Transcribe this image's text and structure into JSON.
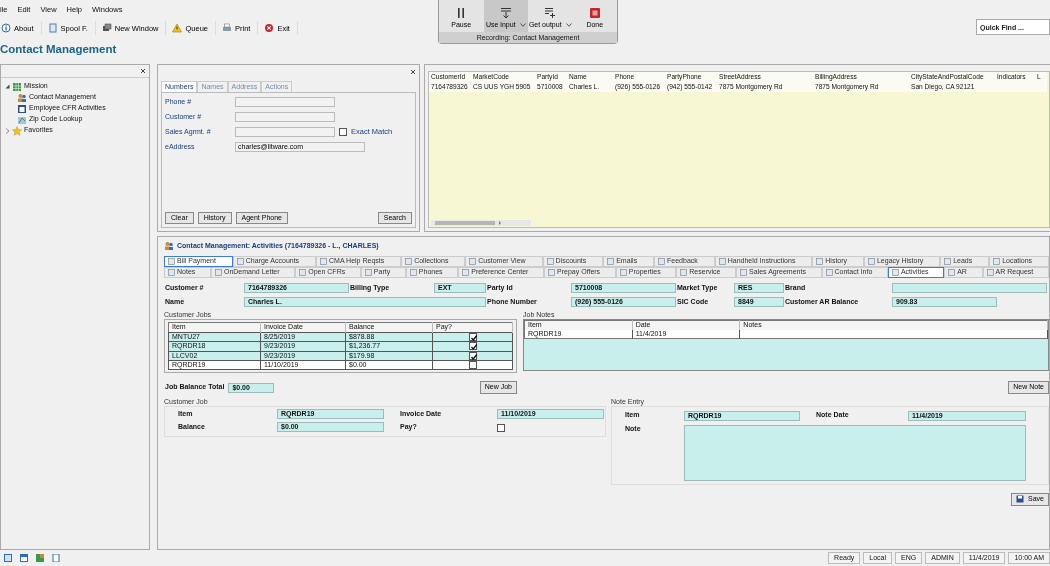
{
  "menu": [
    "ile",
    "Edit",
    "View",
    "Help",
    "Windows"
  ],
  "toolbar": [
    "About",
    "Spool F.",
    "New Window",
    "Queue",
    "Print",
    "Exit"
  ],
  "recorder": {
    "buttons": [
      {
        "label": "Pause",
        "dropdown": false,
        "highlighted": false
      },
      {
        "label": "Use input",
        "dropdown": true,
        "highlighted": true
      },
      {
        "label": "Get output",
        "dropdown": true,
        "highlighted": false
      },
      {
        "label": "Done",
        "dropdown": false,
        "highlighted": false
      }
    ],
    "caption": "Recording: Contact Management"
  },
  "quick_find": {
    "placeholder": "Quick Find ..."
  },
  "page_title": "Contact Management",
  "navigator": {
    "tree": [
      {
        "label": "Mission",
        "expanded": true,
        "children": [
          {
            "label": "Contact Management"
          },
          {
            "label": "Employee CFR Activities"
          },
          {
            "label": "Zip Code Lookup"
          }
        ]
      },
      {
        "label": "Favorites",
        "expanded": false
      }
    ]
  },
  "search": {
    "tabs": [
      {
        "label": "Numbers",
        "selected": true
      },
      {
        "label": "Names",
        "selected": false
      },
      {
        "label": "Address",
        "selected": false
      },
      {
        "label": "Actions",
        "selected": false
      }
    ],
    "fields": [
      {
        "label": "Phone #"
      },
      {
        "label": "Customer #"
      },
      {
        "label": "Sales Agrmt. #",
        "option": {
          "label": "Exact Match",
          "checked": false
        }
      },
      {
        "label": "eAddress",
        "value": "charles@litware.com"
      }
    ],
    "buttons": [
      "Clear",
      "History",
      "Agent Phone",
      "Search"
    ]
  },
  "results": {
    "columns": [
      "CustomerId",
      "MarketCode",
      "PartyId",
      "Name",
      "Phone",
      "PartyPhone",
      "StreetAddress",
      "BillingAddress",
      "CityStateAndPostalCode",
      "Indicators",
      "L"
    ],
    "rows": [
      [
        "7164789326",
        "CS UUS YGH 5905",
        "5710008",
        "Charles L.",
        "(926) 555-0126",
        "(942) 555-0142",
        "7875 Montgomery Rd",
        "7875 Montgomery Rd",
        "San Diego, CA 92121"
      ]
    ]
  },
  "detail": {
    "title": "Contact Management: Activities (7164789326 - L., CHARLES)",
    "tab_rows": [
      [
        {
          "label": "Bill Payment",
          "selected": true
        },
        {
          "label": "Charge Accounts",
          "selected": false
        },
        {
          "label": "CMA Help Reqsts",
          "selected": false
        },
        {
          "label": "Collections",
          "selected": false
        },
        {
          "label": "Customer View",
          "selected": false
        },
        {
          "label": "Discounts",
          "selected": false
        },
        {
          "label": "Emails",
          "selected": false
        },
        {
          "label": "Feedback",
          "selected": false
        },
        {
          "label": "Handheld Instructions",
          "selected": false
        },
        {
          "label": "History",
          "selected": false
        },
        {
          "label": "Legacy History",
          "selected": false
        },
        {
          "label": "Leads",
          "selected": false
        },
        {
          "label": "Locations",
          "selected": false
        }
      ],
      [
        {
          "label": "Notes",
          "selected": false
        },
        {
          "label": "OnDemand Letter",
          "selected": false
        },
        {
          "label": "Open CFRs",
          "selected": false
        },
        {
          "label": "Party",
          "selected": false
        },
        {
          "label": "Phones",
          "selected": false
        },
        {
          "label": "Preference Center",
          "selected": false
        },
        {
          "label": "Prepay Offers",
          "selected": false
        },
        {
          "label": "Properties",
          "selected": false
        },
        {
          "label": "Reservice",
          "selected": false
        },
        {
          "label": "Sales Agreements",
          "selected": false
        },
        {
          "label": "Contact Info",
          "selected": false
        },
        {
          "label": "Activities",
          "selected": true
        },
        {
          "label": "AR",
          "selected": false
        },
        {
          "label": "AR Request",
          "selected": false
        }
      ]
    ],
    "fields": [
      {
        "label": "Customer #",
        "value": "7164789326"
      },
      {
        "label": "Billing Type",
        "value": "EXT"
      },
      {
        "label": "Party Id",
        "value": "5710008"
      },
      {
        "label": "Market Type",
        "value": "RES"
      },
      {
        "label": "Brand"
      },
      {
        "label": "Name",
        "value": "Charles L."
      },
      {
        "label": "Phone Number",
        "value": "(926) 555-0126"
      },
      {
        "label": "SIC Code",
        "value": "8849"
      },
      {
        "label": "Customer AR Balance",
        "value": "909.83"
      }
    ],
    "customer_jobs": {
      "title": "Customer Jobs",
      "columns": [
        "Item",
        "Invoice Date",
        "Balance",
        "Pay?"
      ],
      "rows": [
        {
          "item": "MNTU27",
          "invoice_date": "8/25/2019",
          "balance": "$878.88",
          "pay": true
        },
        {
          "item": "RQRDR18",
          "invoice_date": "9/23/2019",
          "balance": "$1,236.77",
          "pay": true
        },
        {
          "item": "LLCV02",
          "invoice_date": "9/23/2019",
          "balance": "$179.98",
          "pay": true
        },
        {
          "item": "RQRDR19",
          "invoice_date": "11/10/2019",
          "balance": "$0.00",
          "pay": false
        }
      ]
    },
    "job_notes": {
      "title": "Job Notes",
      "columns": [
        "Item",
        "Date",
        "Notes"
      ],
      "rows": [
        {
          "item": "RQRDR19",
          "date": "11/4/2019"
        }
      ]
    },
    "job_balance_total": {
      "label": "Job Balance Total",
      "value": "$0.00"
    },
    "new_job": "New Job",
    "new_note": "New Note",
    "customer_job": {
      "title": "Customer Job",
      "item": {
        "label": "Item",
        "value": "RQRDR19"
      },
      "invoice_date": {
        "label": "Invoice Date",
        "value": "11/10/2019"
      },
      "balance": {
        "label": "Balance",
        "value": "$0.00"
      },
      "pay": {
        "label": "Pay?",
        "checked": false
      }
    },
    "note_entry": {
      "title": "Note Entry",
      "item": {
        "label": "Item",
        "value": "RQRDR19"
      },
      "note_date": {
        "label": "Note Date",
        "value": "11/4/2019"
      },
      "note": {
        "label": "Note"
      }
    },
    "save": "Save"
  },
  "status_bar": [
    "Ready",
    "Local",
    "ENG",
    "ADMIN",
    "11/4/2019",
    "10:00 AM"
  ]
}
